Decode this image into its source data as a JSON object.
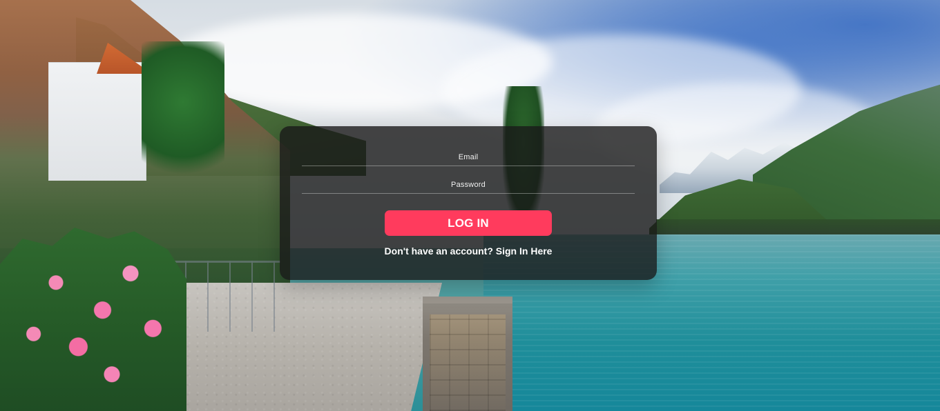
{
  "login_form": {
    "email_placeholder": "Email",
    "password_placeholder": "Password",
    "login_button_label": "LOG IN",
    "signup_prompt_prefix": "Don't have an account?",
    "signup_link_label": "Sign In Here"
  },
  "colors": {
    "login_button": "#ff3b5d",
    "panel_background": "rgba(25,25,25,0.80)",
    "text": "#ffffff"
  }
}
